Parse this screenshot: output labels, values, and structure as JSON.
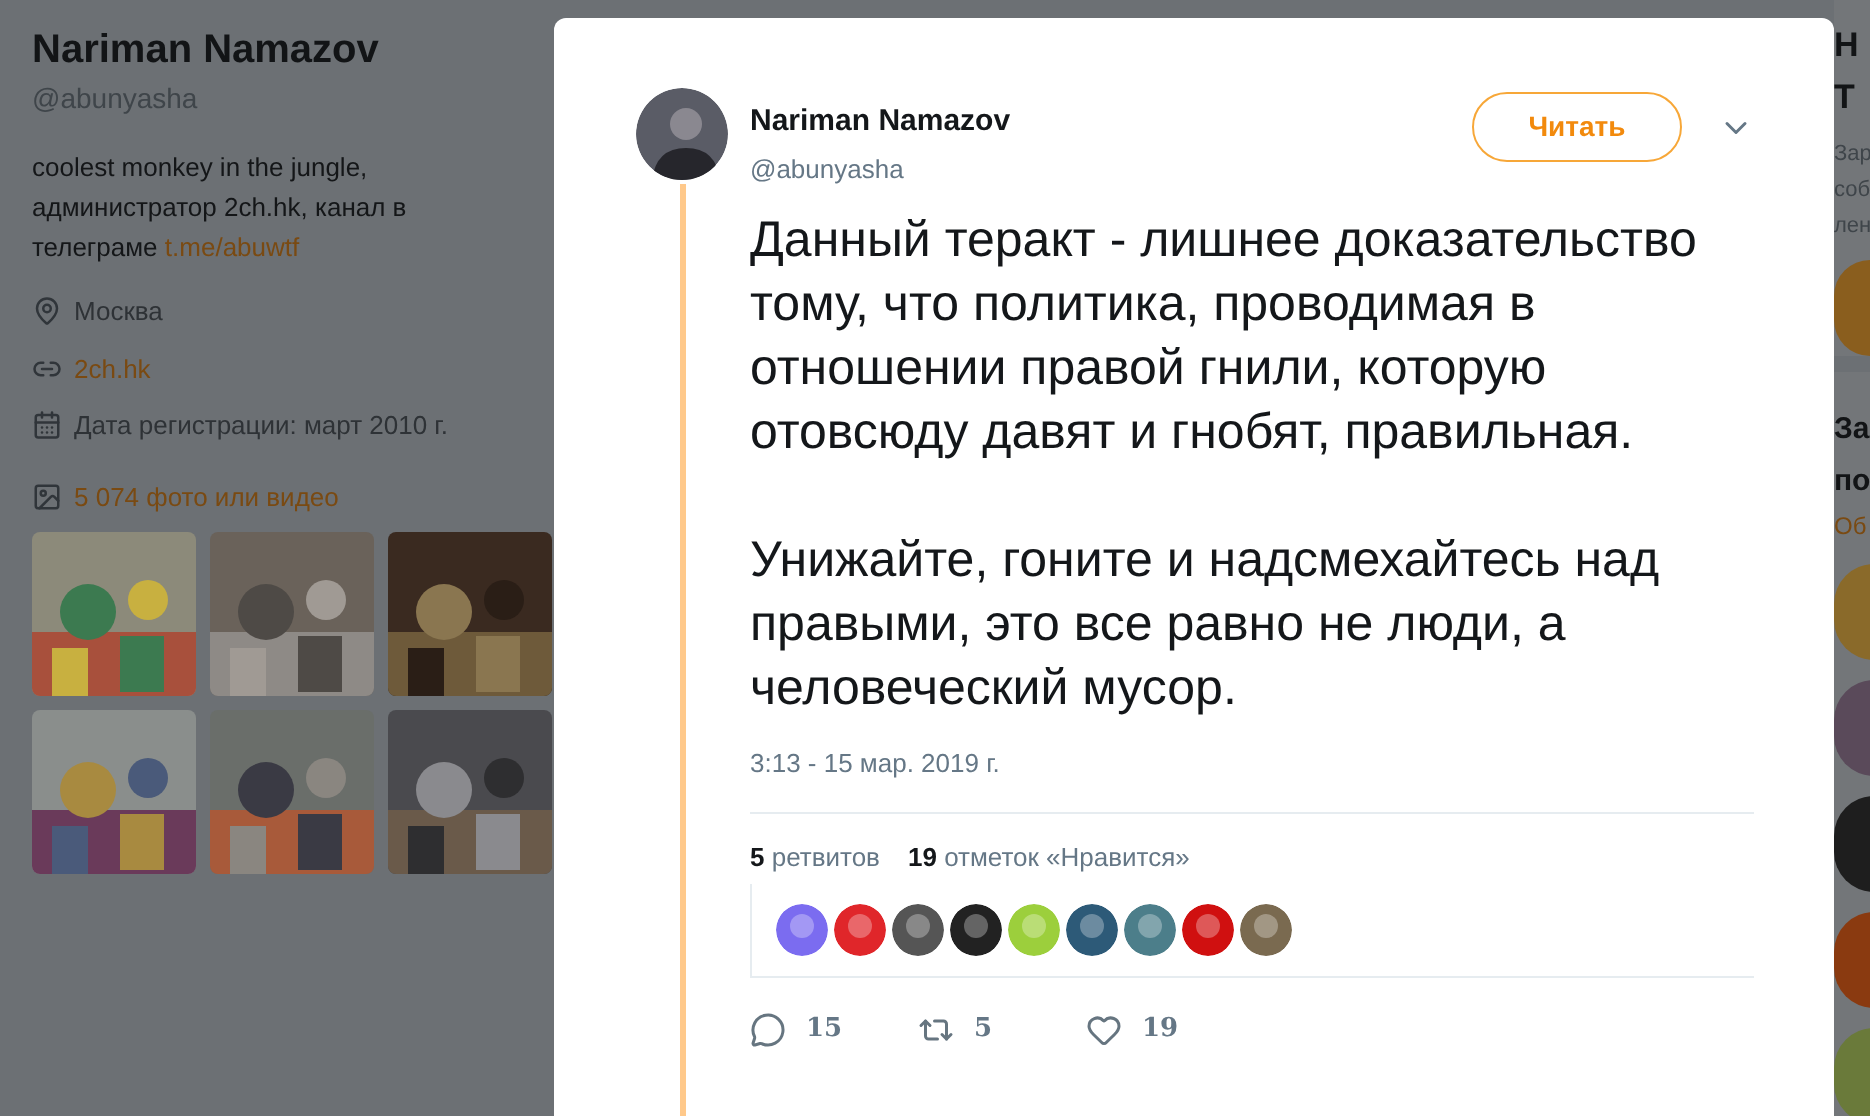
{
  "profile": {
    "name": "Nariman Namazov",
    "handle": "@abunyasha",
    "bio": "coolest monkey in the jungle, администратор 2ch.hk, канал в телеграме",
    "bio_link": "t.me/abuwtf",
    "location": "Москва",
    "website": "2ch.hk",
    "joined": "Дата регистрации: март 2010 г.",
    "media_link": "5 074 фото или видео"
  },
  "media": [
    {
      "kind": "picture"
    },
    {
      "kind": "picture"
    },
    {
      "kind": "picture"
    },
    {
      "kind": "picture"
    },
    {
      "kind": "picture"
    },
    {
      "kind": "picture"
    }
  ],
  "tweet": {
    "author": "Nariman Namazov",
    "handle": "@abunyasha",
    "follow_button": "Читать",
    "paragraphs": [
      "Данный теракт - лишнее доказательство тому, что политика, проводимая в отношении правой гнили, которую отовсюду давят и гнобят, правильная.",
      "Унижайте, гоните и надсмехайтесь над правыми, это все равно не люди, а человеческий мусор."
    ],
    "timestamp": "3:13 - 15 мар. 2019 г.",
    "retweets_count": "5",
    "retweets_label": "ретвитов",
    "likes_count": "19",
    "likes_label": "отметок «Нравится»",
    "likers": [
      {
        "kind": "picture"
      },
      {
        "kind": "picture"
      },
      {
        "kind": "picture"
      },
      {
        "kind": "picture"
      },
      {
        "kind": "picture"
      },
      {
        "kind": "picture"
      },
      {
        "kind": "picture"
      },
      {
        "kind": "picture"
      },
      {
        "kind": "picture"
      }
    ],
    "actions": [
      {
        "kind": "reply",
        "count": "15"
      },
      {
        "kind": "retweet",
        "count": "5"
      },
      {
        "kind": "like",
        "count": "19"
      }
    ]
  },
  "right_column": {
    "card_title_lines": [
      "Н",
      "Т"
    ],
    "card_text_lines": [
      "Зар",
      "соб",
      "лен"
    ],
    "suggest_title_lines": [
      "За",
      "по"
    ],
    "suggest_link": "Об"
  }
}
